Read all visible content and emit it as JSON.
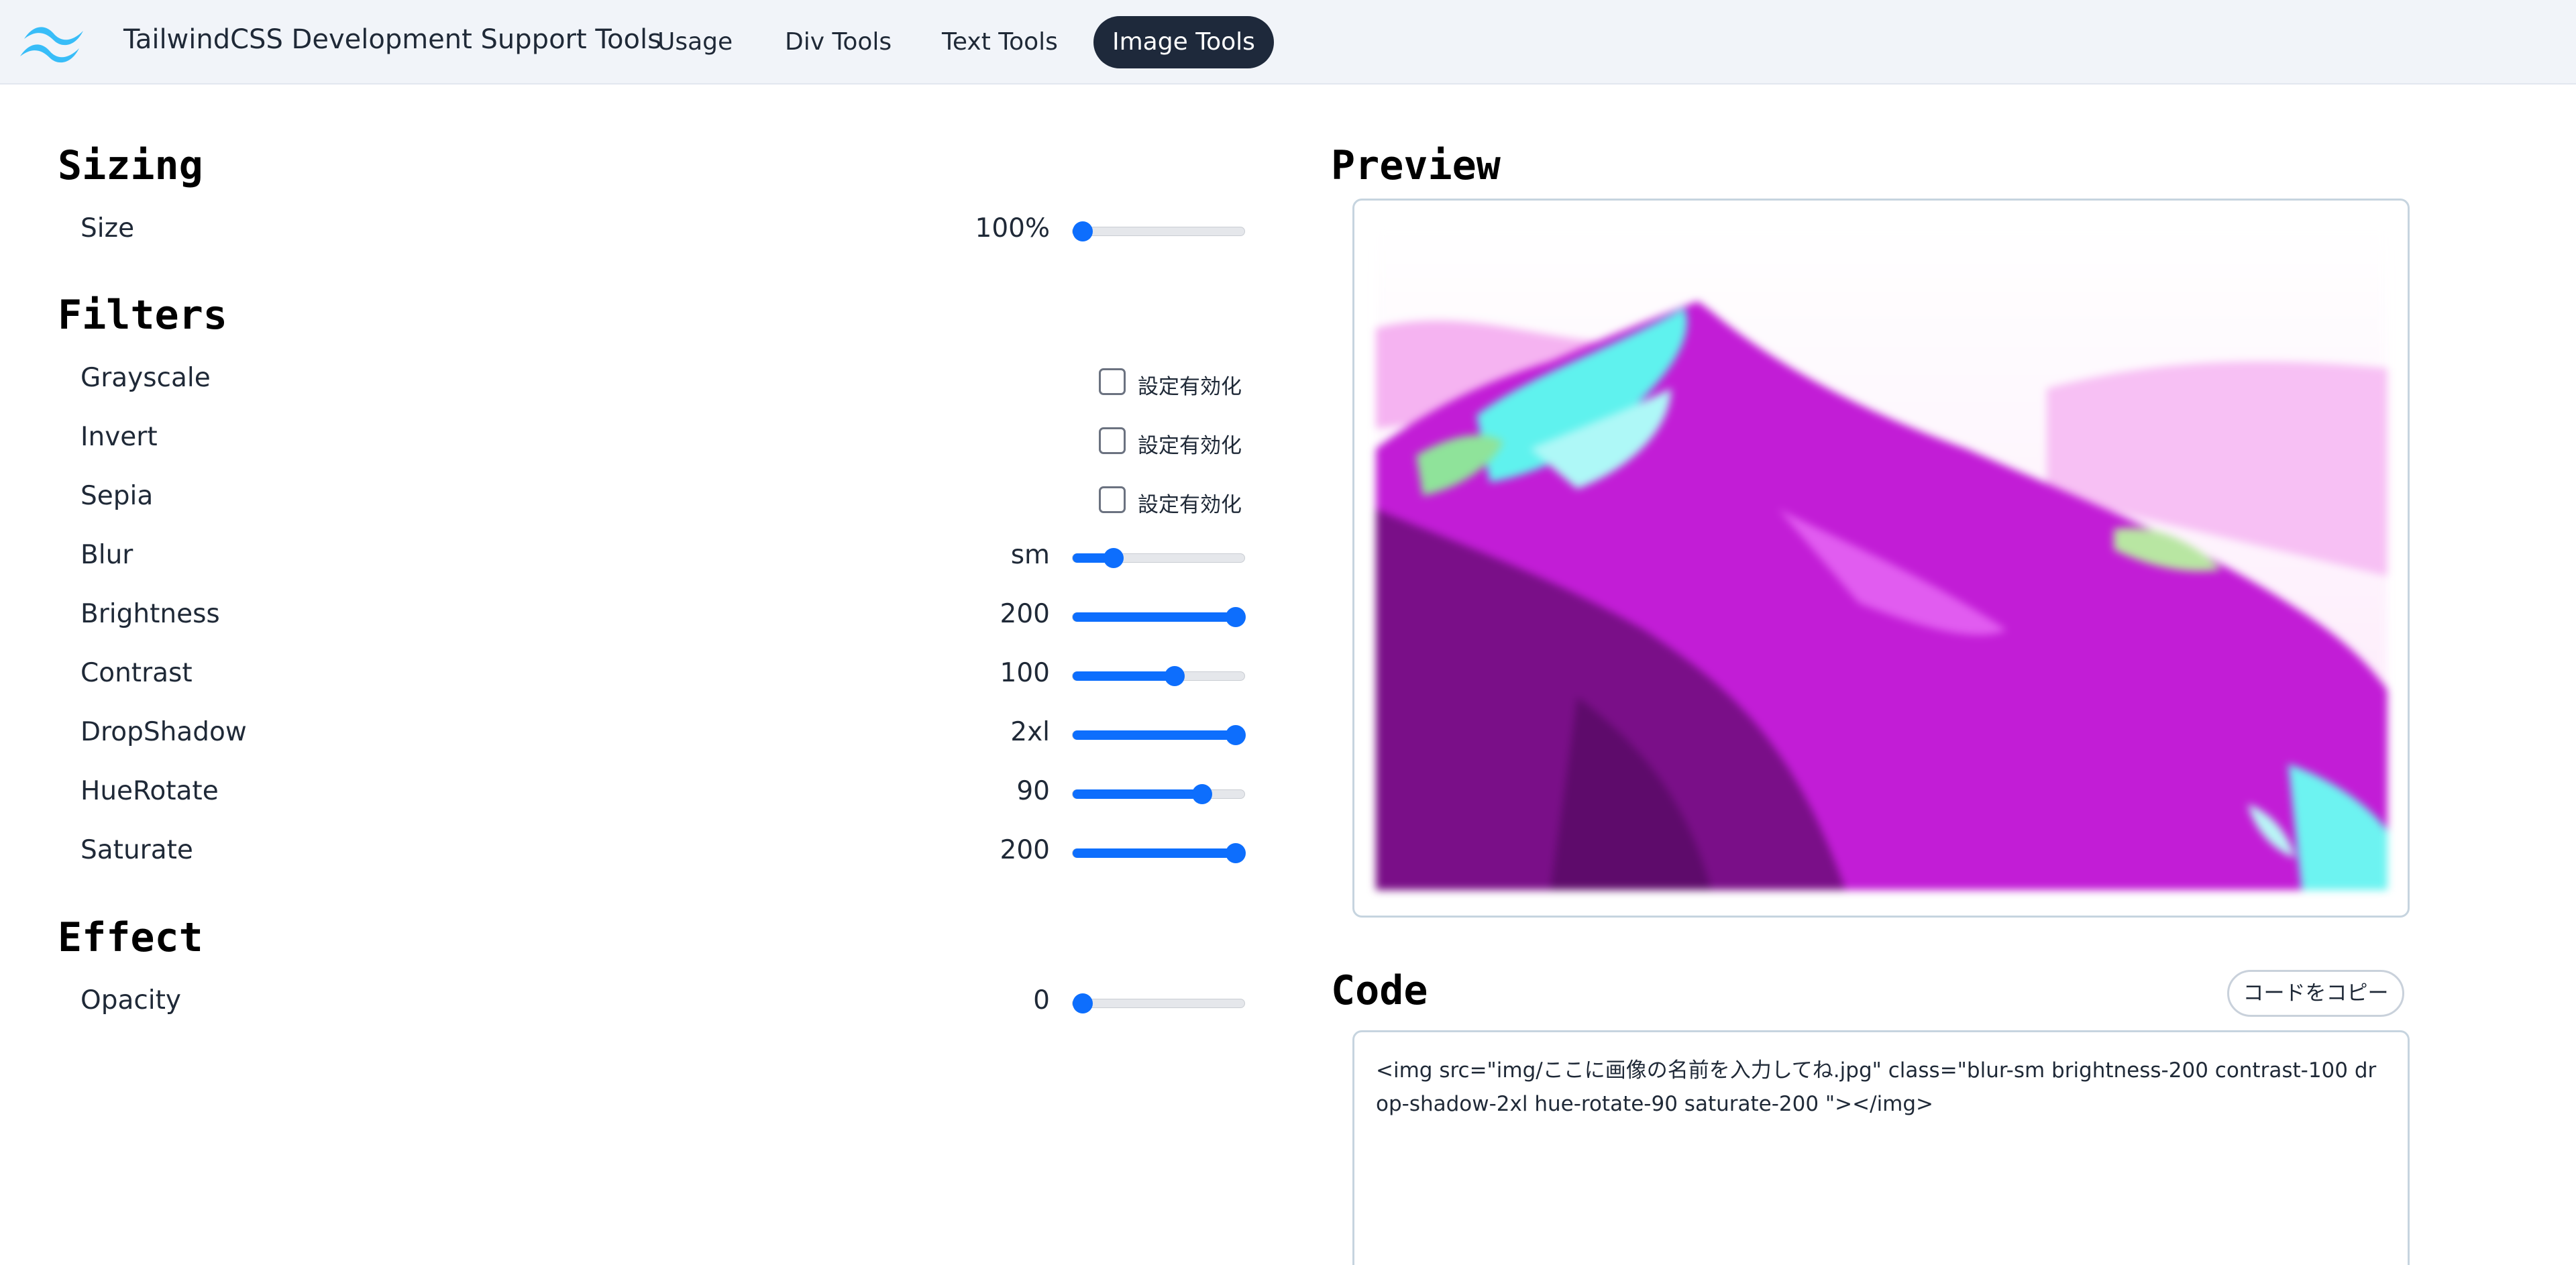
{
  "header": {
    "brand": "TailwindCSS Development Support Tools",
    "nav": [
      "Usage",
      "Div Tools",
      "Text Tools",
      "Image Tools"
    ],
    "active_nav": "Image Tools"
  },
  "sections": {
    "sizing": "Sizing",
    "filters": "Filters",
    "effect": "Effect",
    "preview": "Preview",
    "code": "Code"
  },
  "controls": {
    "size": {
      "label": "Size",
      "value": "100%",
      "level": 0.0
    },
    "grayscale": {
      "label": "Grayscale",
      "checkbox_label": "設定有効化",
      "checked": false
    },
    "invert": {
      "label": "Invert",
      "checkbox_label": "設定有効化",
      "checked": false
    },
    "sepia": {
      "label": "Sepia",
      "checkbox_label": "設定有効化",
      "checked": false
    },
    "blur": {
      "label": "Blur",
      "value": "sm",
      "level": 0.2
    },
    "brightness": {
      "label": "Brightness",
      "value": "200",
      "level": 1.0
    },
    "contrast": {
      "label": "Contrast",
      "value": "100",
      "level": 0.6
    },
    "dropshadow": {
      "label": "DropShadow",
      "value": "2xl",
      "level": 1.0
    },
    "huerotate": {
      "label": "HueRotate",
      "value": "90",
      "level": 0.78
    },
    "saturate": {
      "label": "Saturate",
      "value": "200",
      "level": 1.0
    },
    "opacity": {
      "label": "Opacity",
      "value": "0",
      "level": 0.0
    }
  },
  "code": {
    "copy_button": "コードをコピー",
    "text": "<img src=\"img/ここに画像の名前を入力してね.jpg\" class=\"blur-sm brightness-200 contrast-100 drop-shadow-2xl hue-rotate-90 saturate-200 \"></img>"
  },
  "colors": {
    "accent": "#0d6efd",
    "nav_active_bg": "#1e293b",
    "header_bg": "#f1f4f9"
  }
}
